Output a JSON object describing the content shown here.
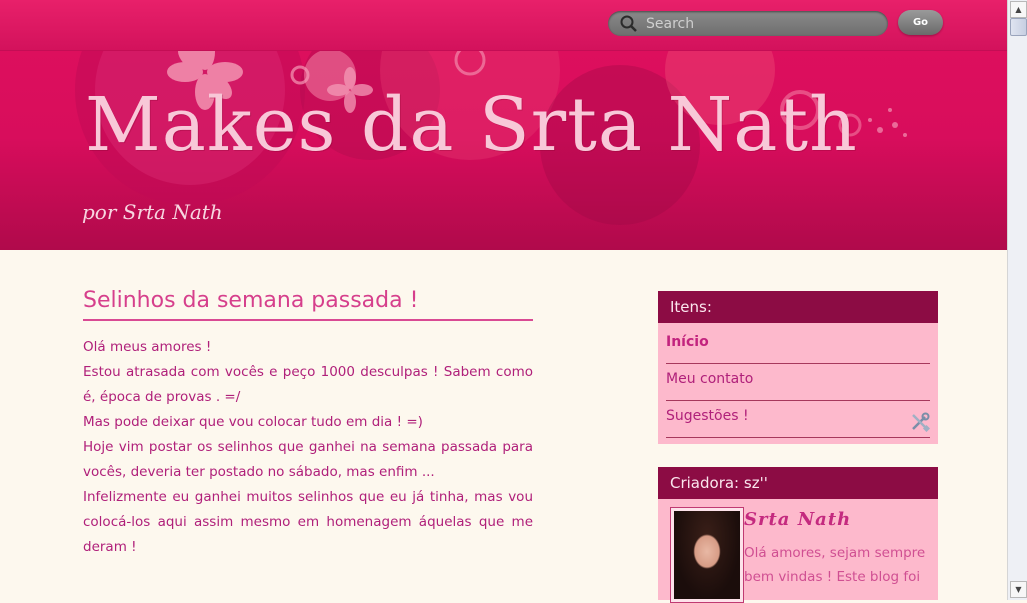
{
  "header": {
    "search_placeholder": "Search",
    "go_label": "Go",
    "blog_title": "Makes da Srta Nath",
    "byline": "por Srta Nath"
  },
  "post": {
    "title": "Selinhos da semana passada !",
    "paragraphs": [
      "Olá meus amores !",
      "Estou atrasada com vocês e peço 1000 desculpas ! Sabem como é, época de provas . =/",
      "Mas pode deixar que vou colocar tudo em dia ! =)",
      "Hoje vim postar os selinhos que ganhei na semana passada para vocês, deveria ter postado no sábado, mas enfim ...",
      "Infelizmente eu ganhei muitos selinhos que eu já tinha, mas vou colocá-los aqui assim mesmo em homenagem áquelas que me deram !"
    ]
  },
  "sidebar": {
    "menu_title": "Itens:",
    "menu_items": [
      "Início",
      "Meu contato",
      "Sugestões !"
    ],
    "profile_title": "Criadora: sz''",
    "profile_name": "Srta Nath",
    "profile_bio": "Olá amores, sejam sempre bem vindas ! Este blog foi"
  },
  "colors": {
    "header": "#d80d5c",
    "accent": "#d63f8c",
    "widget_head": "#8c0c44",
    "widget_bg": "#fdb9cc",
    "page_bg": "#fdf8ee"
  }
}
